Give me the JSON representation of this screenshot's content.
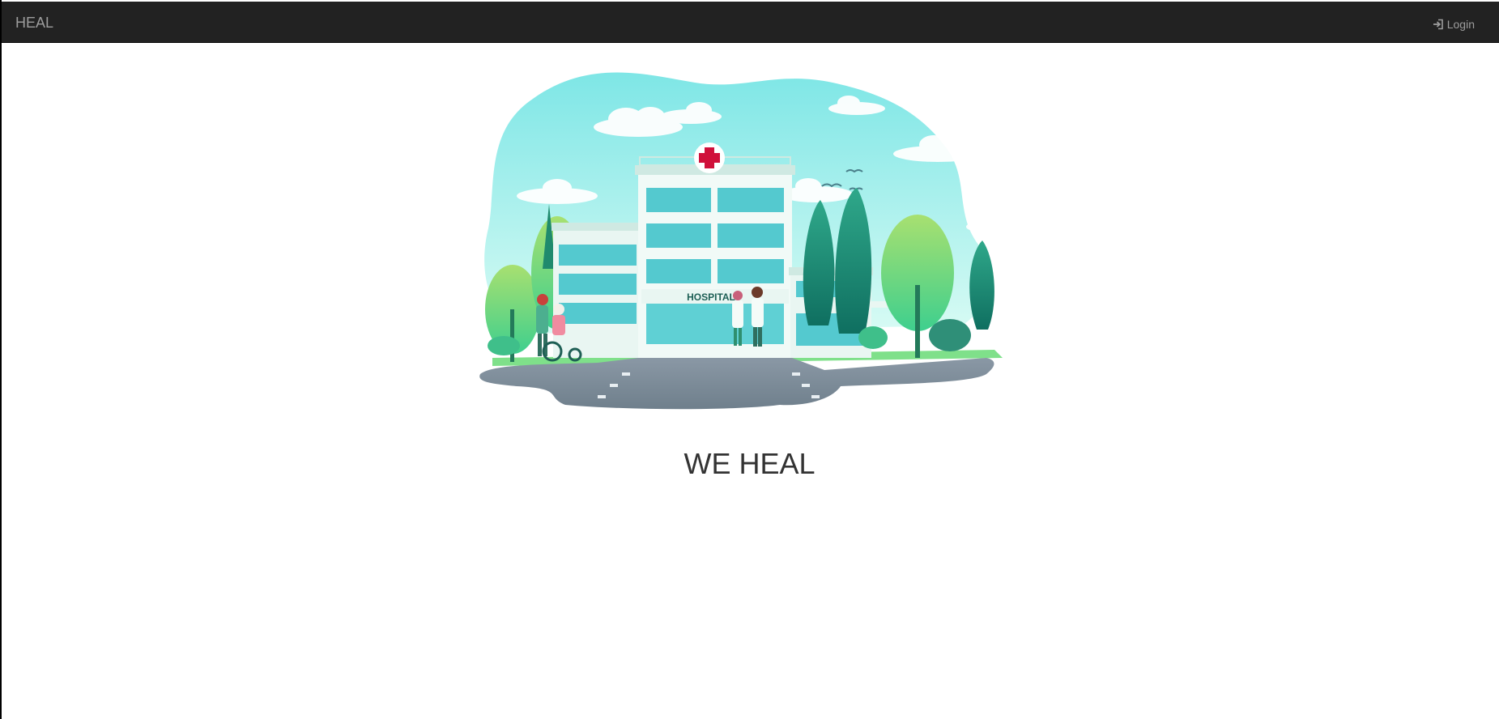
{
  "navbar": {
    "brand": "HEAL",
    "login_label": "Login",
    "login_icon": "login-icon",
    "background": "#222222",
    "text_color": "#9d9d9d"
  },
  "hero": {
    "sign_text": "HOSPITAL",
    "illustration": "hospital-illustration"
  },
  "main": {
    "headline": "WE HEAL"
  }
}
